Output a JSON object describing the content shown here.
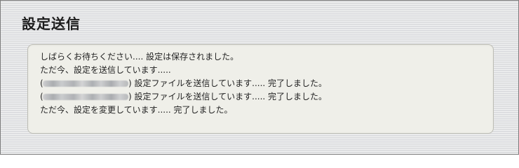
{
  "page": {
    "title": "設定送信"
  },
  "messages": {
    "line1": "しばらくお待ちください.... 設定は保存されました。",
    "line2": "ただ今、設定を送信しています.....",
    "device1": {
      "open": "(",
      "close": ")",
      "status": " 設定ファイルを送信しています..... 完了しました。"
    },
    "device2": {
      "open": "(",
      "close": ")",
      "status": " 設定ファイルを送信しています..... 完了しました。"
    },
    "line5": "ただ今、設定を変更しています..... 完了しました。"
  }
}
